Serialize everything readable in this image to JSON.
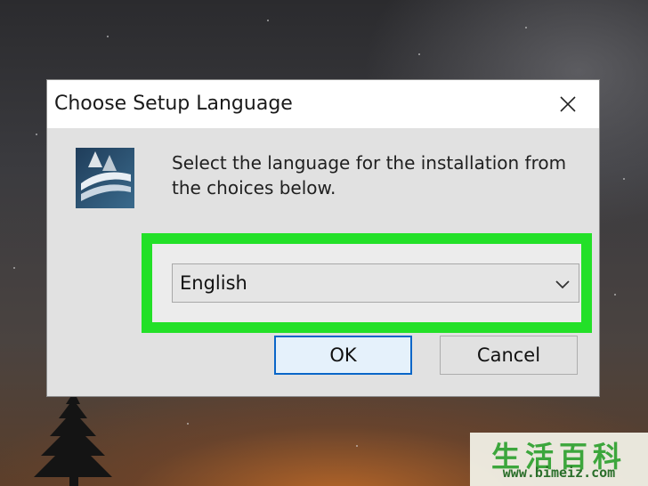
{
  "dialog": {
    "title": "Choose Setup Language",
    "message_line1": "Select the language for the installation from",
    "message_line2": "the choices below.",
    "app_icon": "installer-logo-icon",
    "close_icon": "close-icon"
  },
  "language_select": {
    "selected_value": "English",
    "dropdown_icon": "chevron-down-icon"
  },
  "buttons": {
    "ok_label": "OK",
    "cancel_label": "Cancel"
  },
  "watermark": {
    "chinese_text": "生活百科",
    "url": "www.bimeiz.com"
  },
  "colors": {
    "highlight": "#23e028",
    "ok_border": "#0a66c8"
  }
}
